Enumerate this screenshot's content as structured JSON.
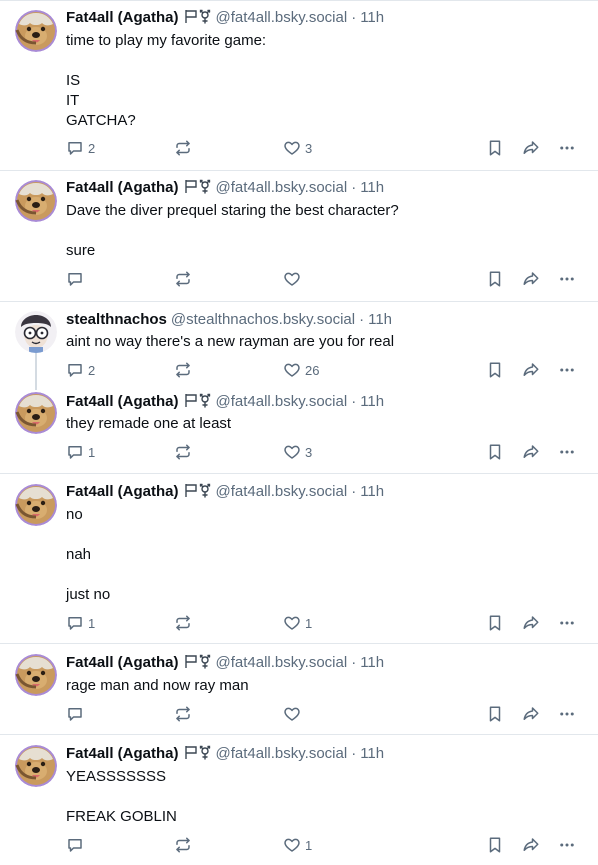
{
  "posts": [
    {
      "display_name": "Fat4all (Agatha)",
      "handle": "@fat4all.bsky.social",
      "separator": "·",
      "time": "11h",
      "text": "time to play my favorite game:\n\nIS\nIT\nGATCHA?",
      "replies": "2",
      "reposts": "",
      "likes": "3",
      "avatar": "dog-avatar",
      "flair": [
        "flag-icon",
        "gender-symbol-icon"
      ]
    },
    {
      "display_name": "Fat4all (Agatha)",
      "handle": "@fat4all.bsky.social",
      "separator": "·",
      "time": "11h",
      "text": "Dave the diver prequel staring the best character?\n\nsure",
      "replies": "",
      "reposts": "",
      "likes": "",
      "avatar": "dog-avatar",
      "flair": [
        "flag-icon",
        "gender-symbol-icon"
      ]
    },
    {
      "display_name": "stealthnachos",
      "handle": "@stealthnachos.bsky.social",
      "separator": "·",
      "time": "11h",
      "text": "aint no way there's a new rayman are you for real",
      "replies": "2",
      "reposts": "",
      "likes": "26",
      "avatar": "cartoon-glasses-avatar",
      "flair": []
    },
    {
      "display_name": "Fat4all (Agatha)",
      "handle": "@fat4all.bsky.social",
      "separator": "·",
      "time": "11h",
      "text": "they remade one at least",
      "replies": "1",
      "reposts": "",
      "likes": "3",
      "avatar": "dog-avatar",
      "flair": [
        "flag-icon",
        "gender-symbol-icon"
      ]
    },
    {
      "display_name": "Fat4all (Agatha)",
      "handle": "@fat4all.bsky.social",
      "separator": "·",
      "time": "11h",
      "text": "no\n\nnah\n\njust no",
      "replies": "1",
      "reposts": "",
      "likes": "1",
      "avatar": "dog-avatar",
      "flair": [
        "flag-icon",
        "gender-symbol-icon"
      ]
    },
    {
      "display_name": "Fat4all (Agatha)",
      "handle": "@fat4all.bsky.social",
      "separator": "·",
      "time": "11h",
      "text": "rage man and now ray man",
      "replies": "",
      "reposts": "",
      "likes": "",
      "avatar": "dog-avatar",
      "flair": [
        "flag-icon",
        "gender-symbol-icon"
      ]
    },
    {
      "display_name": "Fat4all (Agatha)",
      "handle": "@fat4all.bsky.social",
      "separator": "·",
      "time": "11h",
      "text": "YEASSSSSSS\n\nFREAK GOBLIN",
      "replies": "",
      "reposts": "",
      "likes": "1",
      "avatar": "dog-avatar",
      "flair": [
        "flag-icon",
        "gender-symbol-icon"
      ]
    }
  ],
  "icons": {
    "reply": "reply-icon",
    "repost": "repost-icon",
    "like": "heart-icon",
    "bookmark": "bookmark-icon",
    "share": "share-icon",
    "more": "more-icon"
  },
  "colors": {
    "text": "#0b0f14",
    "muted": "#5b6b7c",
    "divider": "#e2e7ec",
    "avatar_ring": "#a98bd6"
  }
}
